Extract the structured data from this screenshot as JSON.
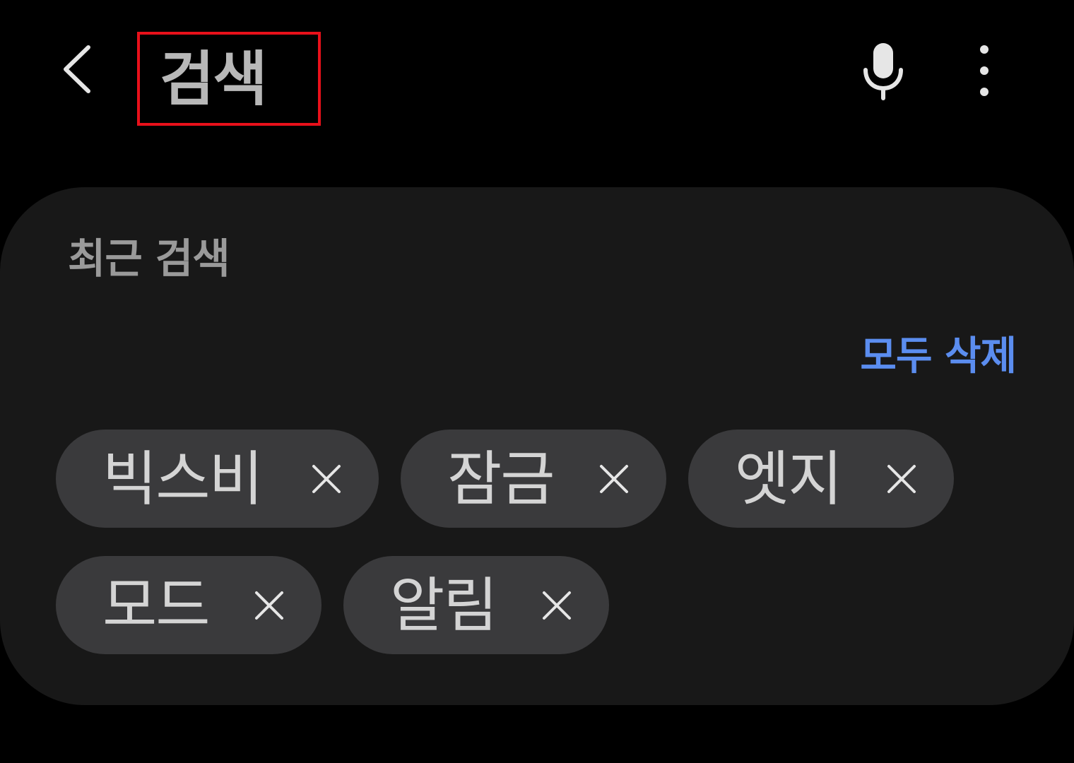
{
  "header": {
    "title": "검색",
    "back_icon": "chevron-left-icon",
    "mic_icon": "microphone-icon",
    "more_icon": "more-vertical-icon"
  },
  "recent": {
    "section_title": "최근 검색",
    "clear_all_label": "모두 삭제",
    "items": [
      {
        "label": "빅스비"
      },
      {
        "label": "잠금"
      },
      {
        "label": "엣지"
      },
      {
        "label": "모드"
      },
      {
        "label": "알림"
      }
    ]
  },
  "colors": {
    "background": "#000000",
    "card": "#181818",
    "chip": "#3a3a3c",
    "accent": "#5b8def",
    "highlight_box": "#e8101a"
  }
}
